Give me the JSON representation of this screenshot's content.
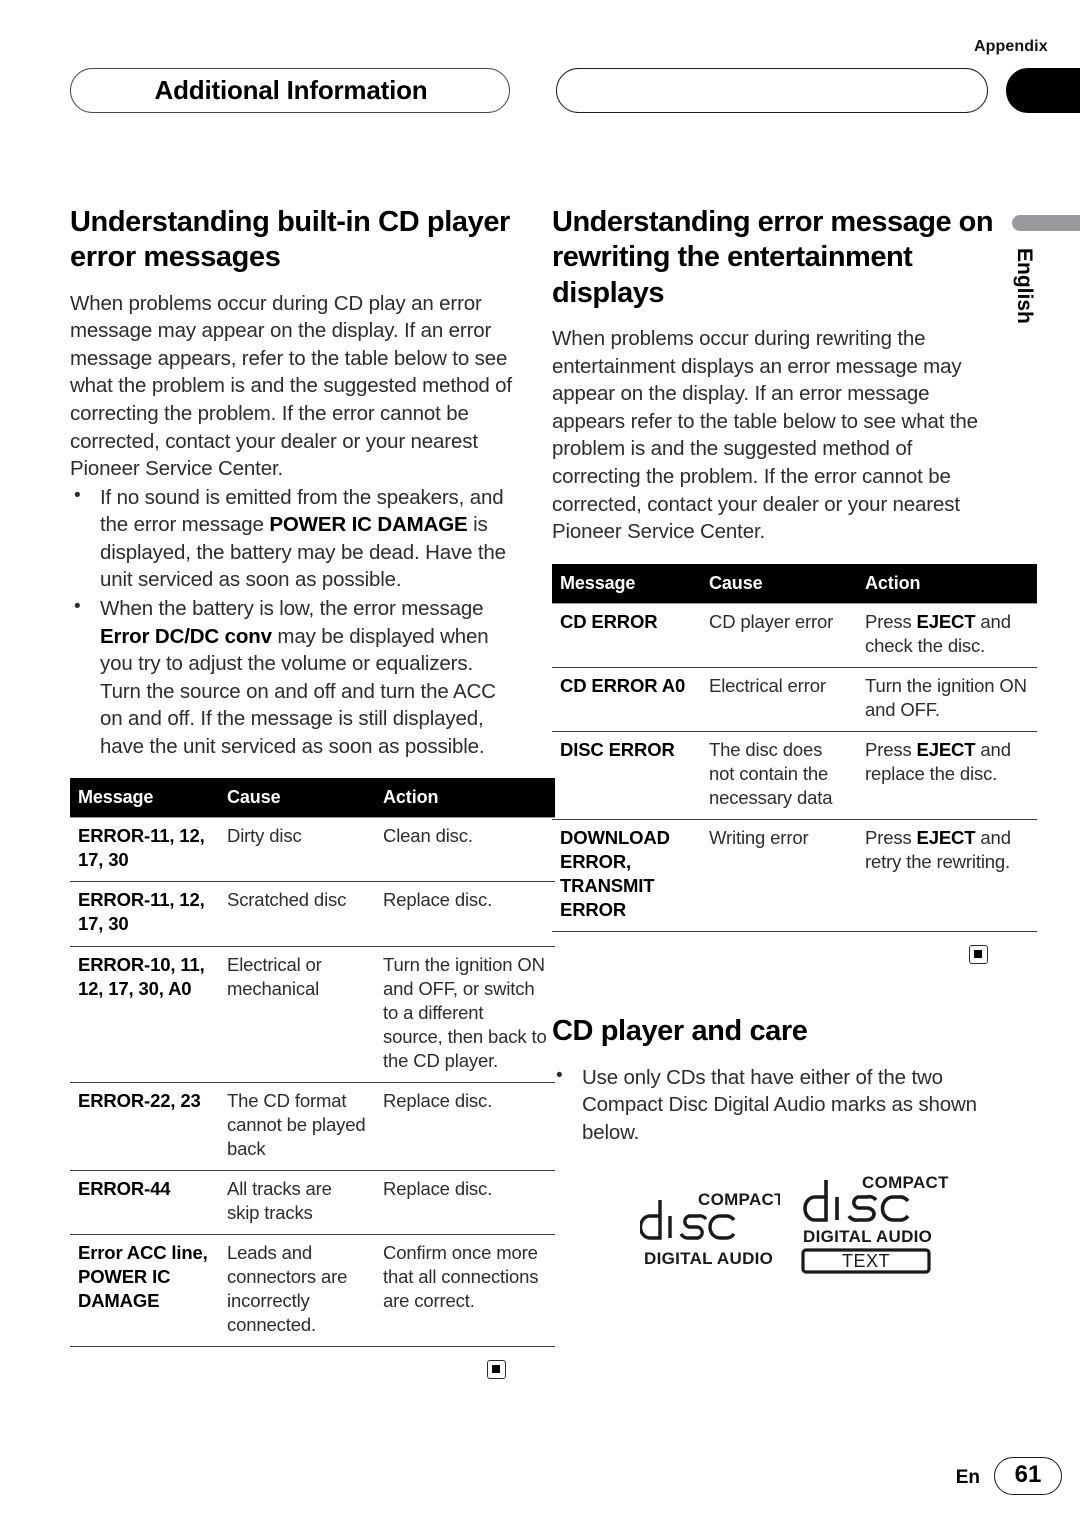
{
  "header": {
    "appendix_label": "Appendix",
    "banner_title": "Additional Information",
    "language_tab": "English"
  },
  "left_column": {
    "heading": "Understanding built-in CD player error messages",
    "intro": "When problems occur during CD play an error message may appear on the display. If an error message appears, refer to the table below to see what the problem is and the suggested method of correcting the problem. If the error cannot be corrected, contact your dealer or your nearest Pioneer Service Center.",
    "bullets": [
      {
        "pre": "If no sound is emitted from the speakers, and the error message ",
        "bold": "POWER IC DAMAGE",
        "post": " is displayed, the battery may be dead. Have the unit serviced as soon as possible."
      },
      {
        "pre": "When the battery is low, the error message ",
        "bold": "Error DC/DC conv",
        "post": " may be displayed when you try to adjust the volume or equalizers. Turn the source on and off and turn the ACC on and off. If the message is still displayed, have the unit serviced as soon as possible."
      }
    ],
    "table": {
      "headers": [
        "Message",
        "Cause",
        "Action"
      ],
      "rows": [
        {
          "message": "ERROR-11, 12, 17, 30",
          "cause": "Dirty disc",
          "action": "Clean disc."
        },
        {
          "message": "ERROR-11, 12, 17, 30",
          "cause": "Scratched disc",
          "action": "Replace disc."
        },
        {
          "message": "ERROR-10, 11, 12, 17, 30, A0",
          "cause": "Electrical or mechanical",
          "action": "Turn the ignition ON and OFF, or switch to a different source, then back to the CD player."
        },
        {
          "message": "ERROR-22, 23",
          "cause": "The CD format cannot be played back",
          "action": "Replace disc."
        },
        {
          "message": "ERROR-44",
          "cause": "All tracks are skip tracks",
          "action": "Replace disc."
        },
        {
          "message": "Error ACC line, POWER IC DAMAGE",
          "cause": "Leads and connectors are incorrectly connected.",
          "action": "Confirm once more that all connections are correct."
        }
      ]
    }
  },
  "right_column": {
    "heading": "Understanding error message on rewriting the entertainment displays",
    "intro": "When problems occur during rewriting the entertainment displays an error message may appear on the display. If an error message appears refer to the table below to see what the problem is and the suggested method of correcting the problem. If the error cannot be corrected, contact your dealer or your nearest Pioneer Service Center.",
    "table": {
      "headers": [
        "Message",
        "Cause",
        "Action"
      ],
      "rows": [
        {
          "message": "CD ERROR",
          "cause": "CD player error",
          "action_pre": "Press ",
          "action_bold": "EJECT",
          "action_post": " and check the disc."
        },
        {
          "message": "CD ERROR A0",
          "cause": "Electrical error",
          "action_pre": "Turn the ignition ON and OFF.",
          "action_bold": "",
          "action_post": ""
        },
        {
          "message": "DISC ERROR",
          "cause": "The disc does not contain the necessary data",
          "action_pre": "Press ",
          "action_bold": "EJECT",
          "action_post": " and replace the disc."
        },
        {
          "message": "DOWNLOAD ERROR, TRANSMIT ERROR",
          "cause": "Writing error",
          "action_pre": "Press ",
          "action_bold": "EJECT",
          "action_post": " and retry the rewriting."
        }
      ]
    },
    "care": {
      "heading": "CD player and care",
      "bullet": "Use only CDs that have either of the two Compact Disc Digital Audio marks as shown below."
    },
    "logos": {
      "audio": {
        "top": "COMPACT",
        "word": "disc",
        "bottom": "DIGITAL AUDIO"
      },
      "text": {
        "top": "COMPACT",
        "word": "disc",
        "bottom": "DIGITAL AUDIO",
        "badge": "TEXT"
      }
    }
  },
  "footer": {
    "language_code": "En",
    "page_number": "61"
  }
}
